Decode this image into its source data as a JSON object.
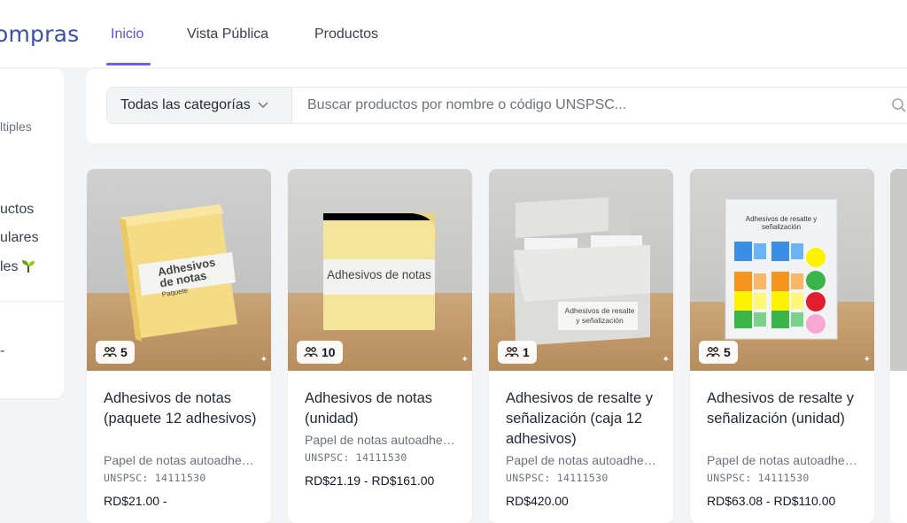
{
  "header": {
    "brand": "ompras",
    "tabs": [
      {
        "label": "Inicio",
        "active": true
      },
      {
        "label": "Vista Pública",
        "active": false
      },
      {
        "label": "Productos",
        "active": false
      }
    ],
    "accent": "#5b4fe0"
  },
  "sidebar": {
    "items": [
      "ltiples",
      "uctos",
      "ulares",
      "les",
      "-"
    ]
  },
  "search": {
    "category_label": "Todas las categorías",
    "placeholder": "Buscar productos por nombre o código UNSPSC..."
  },
  "products": [
    {
      "image_label_1": "Adhesivos",
      "image_label_2": "de notas",
      "image_label_3": "Paquete",
      "badge": "5",
      "title": "Adhesivos de notas (paquete 12 adhesivos)",
      "description": "Papel de notas autoadhesivas",
      "code": "UNSPSC: 14111530",
      "price": "RD$21.00 -"
    },
    {
      "image_label_1": "Adhesivos de notas",
      "badge": "10",
      "title": "Adhesivos de notas (unidad)",
      "description": "Papel de notas autoadhesivas",
      "code": "UNSPSC: 14111530",
      "price": "RD$21.19 - RD$161.00"
    },
    {
      "image_label_1": "Adhesivos de resalte",
      "image_label_2": "y señalización",
      "badge": "1",
      "title": "Adhesivos de resalte y señalización (caja 12 adhesivos)",
      "description": "Papel de notas autoadhesivas",
      "code": "UNSPSC: 14111530",
      "price": "RD$420.00"
    },
    {
      "image_label_1": "Adhesivos de resalte y señalización",
      "badge": "5",
      "title": "Adhesivos de resalte y señalización (unidad)",
      "description": "Papel de notas autoadhesivas",
      "code": "UNSPSC: 14111530",
      "price": "RD$63.08 - RD$110.00"
    }
  ]
}
